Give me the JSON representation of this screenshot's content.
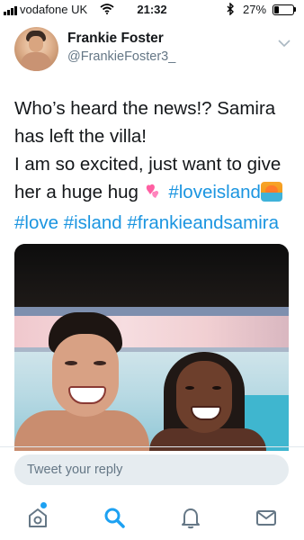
{
  "status_bar": {
    "carrier": "vodafone UK",
    "time": "21:32",
    "battery_percent": "27%",
    "battery_level": 0.27,
    "icons": [
      "signal-icon",
      "wifi-icon",
      "bluetooth-icon",
      "battery-icon"
    ]
  },
  "tweet": {
    "author": {
      "display_name": "Frankie Foster",
      "handle": "@FrankieFoster3_"
    },
    "text": {
      "line1": "Who’s heard the news!? Samira has left the villa!",
      "line2_prefix": "I am so excited, just want to give her a huge hug",
      "emoji_heart": "💕",
      "hashtag_loveisland": "#loveisland",
      "hashtag_love": "#love",
      "hashtag_island": "#island",
      "hashtag_frankieandsamira": "#frankieandsamira"
    },
    "menu_icon": "chevron-down-icon"
  },
  "reply": {
    "placeholder": "Tweet your reply"
  },
  "tab_bar": {
    "items": [
      {
        "name": "home",
        "icon": "home-icon",
        "has_notification_dot": true
      },
      {
        "name": "search",
        "icon": "search-icon",
        "active": true
      },
      {
        "name": "notifications",
        "icon": "bell-icon"
      },
      {
        "name": "messages",
        "icon": "mail-icon"
      }
    ]
  },
  "colors": {
    "link": "#1b95e0",
    "accent": "#1da1f2",
    "secondary_text": "#657786",
    "reply_bg": "#e6ecf0"
  }
}
